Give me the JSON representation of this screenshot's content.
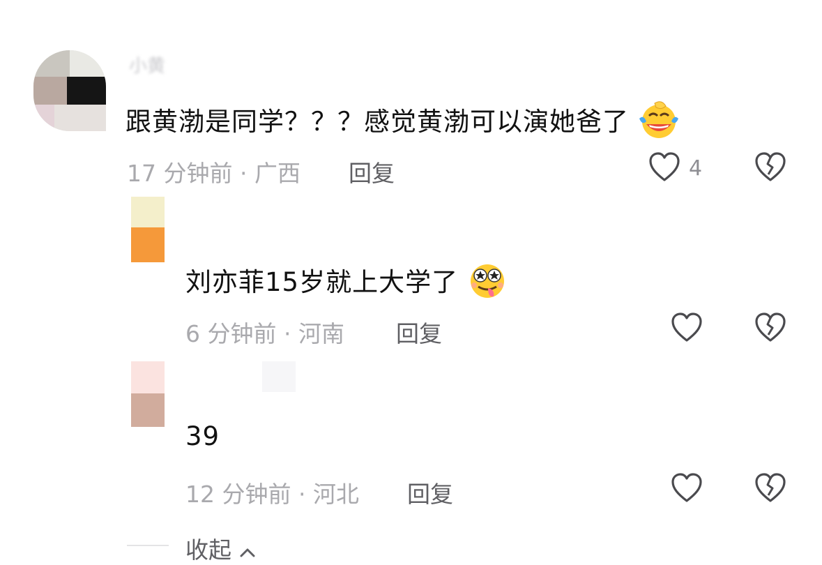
{
  "comments": [
    {
      "username": "小黄",
      "text": "跟黄渤是同学？？？感觉黄渤可以演她爸了",
      "emoji": "laughing-tears-emoji",
      "meta": "17 分钟前 · 广西",
      "reply_label": "回复",
      "like_count": "4"
    }
  ],
  "replies": [
    {
      "text": "刘亦菲15岁就上大学了",
      "emoji": "star-eyes-tongue-emoji",
      "meta": "6 分钟前 · 河南",
      "reply_label": "回复"
    },
    {
      "text": "39",
      "meta": "12 分钟前 · 河北",
      "reply_label": "回复"
    }
  ],
  "footer": {
    "collapse_label": "收起"
  },
  "icons": {
    "like": "heart-outline-icon",
    "dislike": "broken-heart-icon",
    "collapse": "chevron-up-icon"
  },
  "colors": {
    "text_primary": "#111111",
    "text_meta": "#a9a9ad",
    "text_action": "#5f5f63",
    "icon": "#4a4a4e"
  }
}
